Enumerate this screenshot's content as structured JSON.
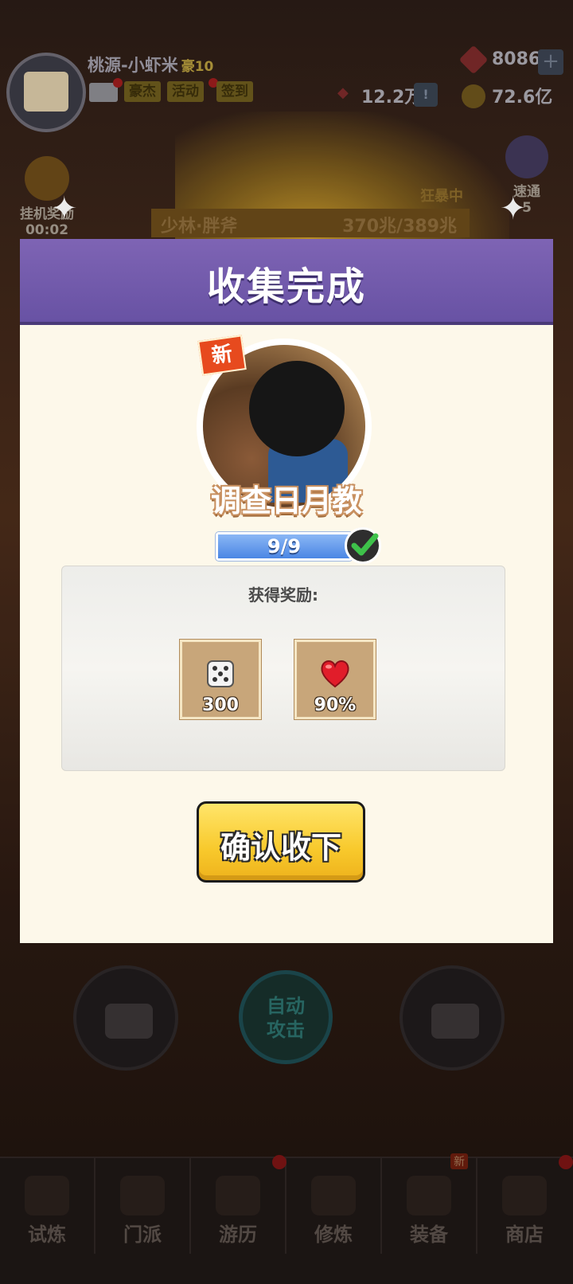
{
  "header": {
    "player_name": "桃源-小虾米",
    "vip": "豪10",
    "chips": [
      "豪杰",
      "活动",
      "签到"
    ],
    "gems": "8086",
    "power": "12.2万",
    "gold": "72.6亿"
  },
  "side_left": {
    "label": "挂机奖励",
    "timer": "00:02"
  },
  "side_right": {
    "label": "速通",
    "count": "5"
  },
  "boss": {
    "name": "少林·胖斧",
    "hp": "370兆/389兆",
    "status": "狂暴中"
  },
  "modal": {
    "title": "收集完成",
    "new_badge": "新",
    "character_name": "调查日月教",
    "progress_text": "9/9",
    "progress_value": 1.0,
    "rewards_title": "获得奖励:",
    "rewards": [
      {
        "icon": "dice-icon",
        "value": "300"
      },
      {
        "icon": "heart-icon",
        "value": "90%"
      }
    ],
    "confirm_label": "确认收下"
  },
  "controls": {
    "auto_label_1": "自动",
    "auto_label_2": "攻击"
  },
  "bottom_nav": [
    {
      "label": "试炼",
      "icon": "ninja-icon"
    },
    {
      "label": "门派",
      "icon": "temple-icon"
    },
    {
      "label": "游历",
      "icon": "mountain-icon"
    },
    {
      "label": "修炼",
      "icon": "book-icon"
    },
    {
      "label": "装备",
      "icon": "sword-icon",
      "tag": "新"
    },
    {
      "label": "商店",
      "icon": "shop-icon"
    }
  ],
  "colors": {
    "modal_header": "#6852a4",
    "modal_bg": "#fdf8ea",
    "confirm_button": "#f8c92c",
    "progress": "#4b86e4"
  }
}
